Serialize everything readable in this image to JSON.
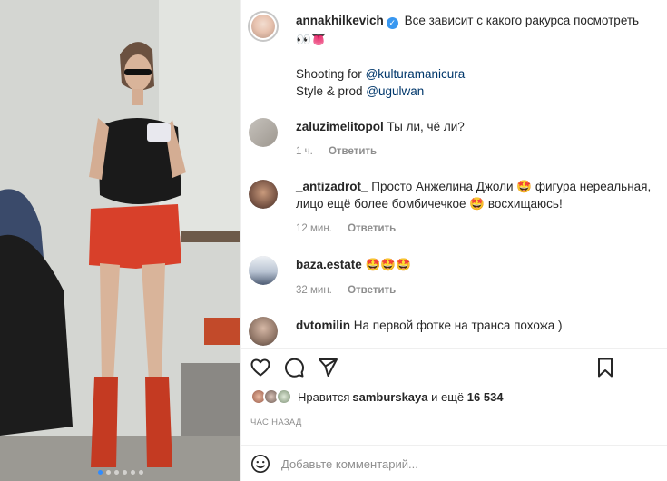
{
  "post": {
    "author": "annakhilkevich",
    "caption_line1": "Все зависит с какого ракурса посмотреть",
    "caption_emojis": "👀👅",
    "shooting_prefix": "Shooting for ",
    "shooting_mention": "@kulturamanicura",
    "style_prefix": "Style & prod ",
    "style_mention": "@ugulwan"
  },
  "comments": [
    {
      "user": "zaluzimelitopol",
      "text": "Ты ли, чё ли?",
      "time": "1 ч.",
      "reply": "Ответить"
    },
    {
      "user": "_antizadrot_",
      "text": "Просто Анжелина Джоли 🤩 фигура нереальная, лицо ещё более бомбичечкое 🤩 восхищаюсь!",
      "time": "12 мин.",
      "reply": "Ответить"
    },
    {
      "user": "baza.estate",
      "text": "🤩🤩🤩",
      "time": "32 мин.",
      "reply": "Ответить"
    },
    {
      "user": "dvtomilin",
      "text": "На первой фотке на транса похожа )"
    }
  ],
  "likes": {
    "prefix": "Нравится ",
    "user": "samburskaya",
    "middle": " и ещё ",
    "count": "16 534"
  },
  "timestamp": "ЧАС НАЗАД",
  "comment_input": {
    "placeholder": "Добавьте комментарий..."
  },
  "carousel": {
    "total": 6,
    "active": 0
  },
  "colors": {
    "mention": "#00376b",
    "verified": "#3897f0",
    "active_dot": "#2f8cff",
    "meta": "#8e8e8e"
  }
}
